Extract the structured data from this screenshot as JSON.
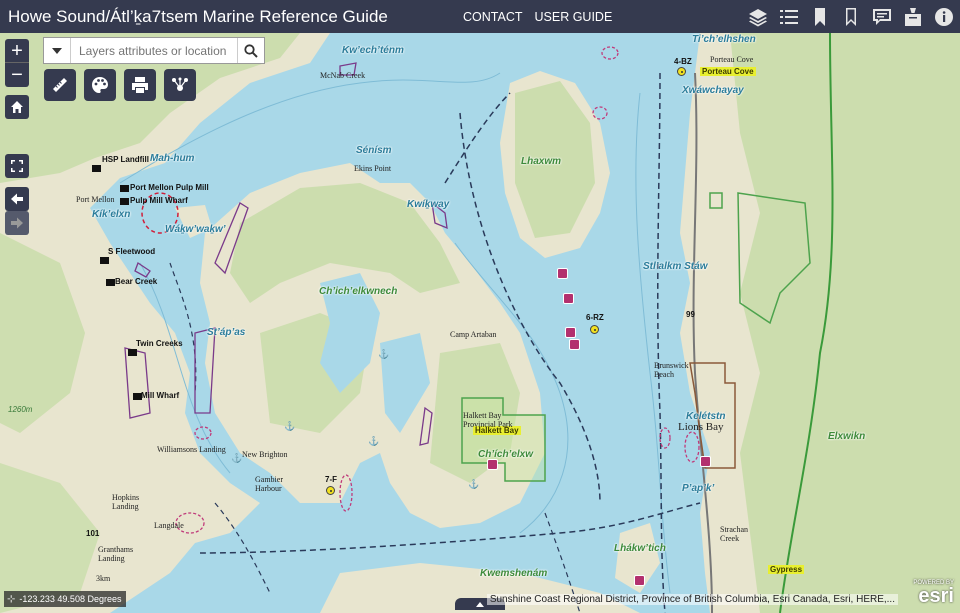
{
  "header": {
    "title": "Howe Sound/Átl’ḵa7tsem Marine Reference Guide",
    "links": [
      "CONTACT",
      "USER GUIDE"
    ],
    "tools": [
      "layers-icon",
      "layer-list-icon",
      "bookmark-icon",
      "bookmark-outline-icon",
      "comment-icon",
      "basemap-icon",
      "info-icon"
    ]
  },
  "search": {
    "placeholder": "Layers attributes or location"
  },
  "coords": {
    "text": "-123.233 49.508 Degrees"
  },
  "attribution": "Sunshine Coast Regional District, Province of British Columbia, Esri Canada, Esri, HERE,...",
  "esri": {
    "powered": "POWERED BY",
    "logo": "esri"
  },
  "map_labels": {
    "native": [
      "Kw’ech’ténm",
      "Mah-hum",
      "Kík’elxn",
      "Wáḵw’waḵw’",
      "Sénísm",
      "Kwíḵway",
      "Ch’ich’elkwnech",
      "St’áp’as",
      "Lhaxwm",
      "Ch’ích’elxw",
      "Stl’alkm Stáw",
      "Xwáwchayay",
      "Ti’ch’elhshen",
      "Kelétstn",
      "P’ap’k’",
      "Lhákw’tich",
      "Kwemshenám",
      "Elxwikn"
    ],
    "poi": [
      "HSP Landfill",
      "Port Mellon Pulp Mill",
      "Pulp Mill Wharf",
      "S Fleetwood",
      "Bear Creek",
      "Twin Creeks",
      "Mill Wharf",
      "6-RZ",
      "7-F",
      "4-BZ"
    ],
    "yellow": [
      "Halkett Bay",
      "Porteau Cove",
      "Gypress"
    ],
    "places": [
      "Port Mellon",
      "McNab Creek",
      "Ekins Point",
      "Camp Artaban",
      "Halkett Bay Provincial Park",
      "Williamsons Landing",
      "New Brighton",
      "Gambier Harbour",
      "Hopkins Landing",
      "Langdale",
      "Granthams Landing",
      "Brunswick Beach",
      "Lions Bay",
      "Strachan Creek",
      "Porteau Cove",
      "1260m",
      "3km",
      "101",
      "99"
    ]
  },
  "colors": {
    "header": "#353a4f",
    "water": "#a9d8e8",
    "land": "#eae8d2",
    "forest": "#cfe3b2",
    "marker": "#b3306e",
    "native_label": "#2a7c9a"
  }
}
